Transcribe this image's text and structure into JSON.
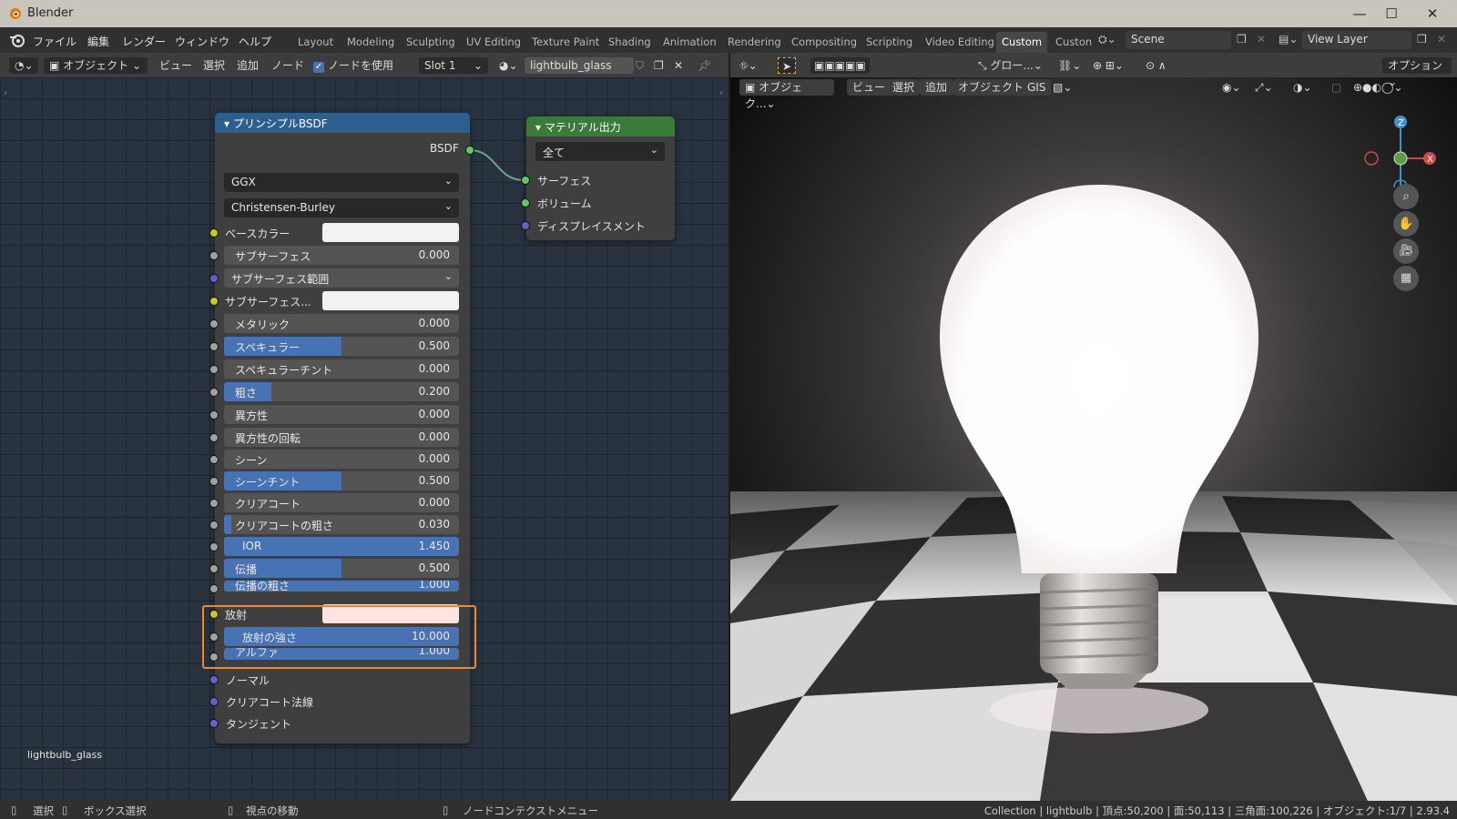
{
  "window": {
    "title": "Blender",
    "minimize": "—",
    "maximize": "☐",
    "close": "✕"
  },
  "menu": [
    "ファイル",
    "編集",
    "レンダー",
    "ウィンドウ",
    "ヘルプ"
  ],
  "workspaces": [
    "Layout",
    "Modeling",
    "Sculpting",
    "UV Editing",
    "Texture Paint",
    "Shading",
    "Animation",
    "Rendering",
    "Compositing",
    "Scripting",
    "Video Editing",
    "Custom",
    "Custon"
  ],
  "active_workspace": "Custom",
  "scene_name": "Scene",
  "view_layer": "View Layer",
  "node_header": {
    "mode": "オブジェクト",
    "view": "ビュー",
    "select": "選択",
    "add": "追加",
    "node": "ノード",
    "use_nodes": "ノードを使用",
    "slot": "Slot 1",
    "material": "lightbulb_glass"
  },
  "principled_node": {
    "title": "プリンシプルBSDF",
    "output": "BSDF",
    "distribution": "GGX",
    "subsurface_method": "Christensen-Burley",
    "base_color_label": "ベースカラー",
    "subsurface_label": "サブサーフェス",
    "subsurface_value": "0.000",
    "subsurface_radius_label": "サブサーフェス範囲",
    "subsurface_color_label": "サブサーフェス...",
    "metallic_label": "メタリック",
    "metallic_value": "0.000",
    "specular_label": "スペキュラー",
    "specular_value": "0.500",
    "specular_tint_label": "スペキュラーチント",
    "specular_tint_value": "0.000",
    "roughness_label": "粗さ",
    "roughness_value": "0.200",
    "anisotropic_label": "異方性",
    "anisotropic_value": "0.000",
    "anisotropic_rotation_label": "異方性の回転",
    "anisotropic_rotation_value": "0.000",
    "sheen_label": "シーン",
    "sheen_value": "0.000",
    "sheen_tint_label": "シーンチント",
    "sheen_tint_value": "0.500",
    "clearcoat_label": "クリアコート",
    "clearcoat_value": "0.000",
    "clearcoat_roughness_label": "クリアコートの粗さ",
    "clearcoat_roughness_value": "0.030",
    "ior_label": "IOR",
    "ior_value": "1.450",
    "transmission_label": "伝播",
    "transmission_value": "0.500",
    "transmission_roughness_label": "伝播の粗さ",
    "transmission_roughness_value": "1.000",
    "emission_label": "放射",
    "emission_strength_label": "放射の強さ",
    "emission_strength_value": "10.000",
    "alpha_label": "アルファ",
    "alpha_value": "1.000",
    "normal_label": "ノーマル",
    "clearcoat_normal_label": "クリアコート法線",
    "tangent_label": "タンジェント"
  },
  "output_node": {
    "title": "マテリアル出力",
    "target": "全て",
    "surface": "サーフェス",
    "volume": "ボリューム",
    "displacement": "ディスプレイスメント"
  },
  "node_editor_material_label": "lightbulb_glass",
  "viewport_header": {
    "transform": "グロー...",
    "options": "オプション",
    "mode": "オブジェク...",
    "view": "ビュー",
    "select": "選択",
    "add": "追加",
    "object": "オブジェクト",
    "gis": "GIS"
  },
  "gizmo": {
    "x": "X",
    "y": "Y",
    "z": "Z"
  },
  "statusbar": {
    "select": "選択",
    "box_select": "ボックス選択",
    "pan": "視点の移動",
    "context_menu": "ノードコンテクストメニュー",
    "stats": "Collection | lightbulb | 頂点:50,200 | 面:50,113 | 三角面:100,226 | オブジェクト:1/7 | 2.93.4"
  },
  "colors": {
    "accent_blue": "#4772b3",
    "highlight_orange": "#f08a24",
    "bsdf_header": "#2e5e8e",
    "output_header": "#3a7a3a",
    "emission_color": "#ffe4e0"
  }
}
